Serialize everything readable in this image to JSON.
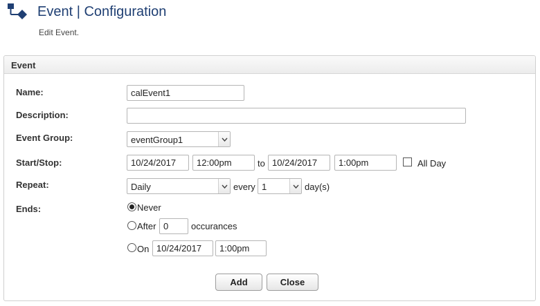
{
  "header": {
    "title": "Event | Configuration",
    "subtitle": "Edit Event."
  },
  "panel": {
    "title": "Event"
  },
  "form": {
    "name": {
      "label": "Name:",
      "value": "calEvent1"
    },
    "description": {
      "label": "Description:",
      "value": ""
    },
    "event_group": {
      "label": "Event Group:",
      "selected": "eventGroup1"
    },
    "start_stop": {
      "label": "Start/Stop:",
      "start_date": "10/24/2017",
      "start_time": "12:00pm",
      "to_text": "to",
      "end_date": "10/24/2017",
      "end_time": "1:00pm",
      "all_day_label": "All Day",
      "all_day_checked": false
    },
    "repeat": {
      "label": "Repeat:",
      "selected": "Daily",
      "every_text": "every",
      "interval_selected": "1",
      "unit_text": "day(s)"
    },
    "ends": {
      "label": "Ends:",
      "selected": "never",
      "never_label": "Never",
      "after_label": "After",
      "after_value": "0",
      "occurrences_text": "occurances",
      "on_label": "On",
      "on_date": "10/24/2017",
      "on_time": "1:00pm"
    }
  },
  "buttons": {
    "add_label": "Add",
    "close_label": "Close"
  },
  "colors": {
    "title": "#1f3f73",
    "icon": "#1f3f73"
  },
  "icons": {
    "app": "flow-diagram-icon",
    "dropdown": "chevron-down-icon"
  }
}
